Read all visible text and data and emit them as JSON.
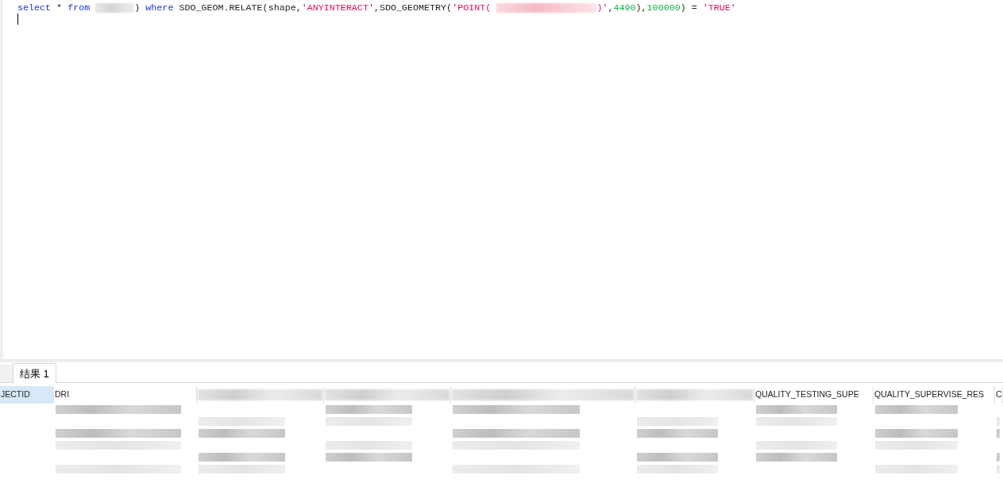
{
  "editor": {
    "tokens": [
      {
        "kind": "keyword",
        "text": "select"
      },
      {
        "kind": "plain",
        "text": " * "
      },
      {
        "kind": "keyword",
        "text": "from"
      },
      {
        "kind": "redacted"
      },
      {
        "kind": "plain",
        "text": ") "
      },
      {
        "kind": "keyword",
        "text": "where"
      },
      {
        "kind": "plain",
        "text": " SDO_GEOM.RELATE(shape,"
      },
      {
        "kind": "string",
        "text": "'ANYINTERACT'"
      },
      {
        "kind": "plain",
        "text": ",SDO_GEOMETRY("
      },
      {
        "kind": "string",
        "text": "'POINT("
      },
      {
        "kind": "redacted"
      },
      {
        "kind": "string",
        "text": ")'"
      },
      {
        "kind": "plain",
        "text": ","
      },
      {
        "kind": "number",
        "text": "4490"
      },
      {
        "kind": "plain",
        "text": "),"
      },
      {
        "kind": "number",
        "text": "100000"
      },
      {
        "kind": "plain",
        "text": ") = "
      },
      {
        "kind": "string",
        "text": "'TRUE'"
      }
    ]
  },
  "result_tabs": [
    {
      "label": "结果 1",
      "selected": true
    }
  ],
  "table": {
    "columns": [
      {
        "kind": "text",
        "label": "JECTID",
        "selected": true
      },
      {
        "kind": "text",
        "label": "DRI",
        "selected": false
      },
      {
        "kind": "redacted"
      },
      {
        "kind": "redacted"
      },
      {
        "kind": "redacted"
      },
      {
        "kind": "redacted"
      },
      {
        "kind": "text",
        "label": "QUALITY_TESTING_SUPE",
        "selected": false
      },
      {
        "kind": "text",
        "label": "QUALITY_SUPERVISE_RES",
        "selected": false
      },
      {
        "kind": "text",
        "label": "C",
        "selected": false
      }
    ]
  }
}
